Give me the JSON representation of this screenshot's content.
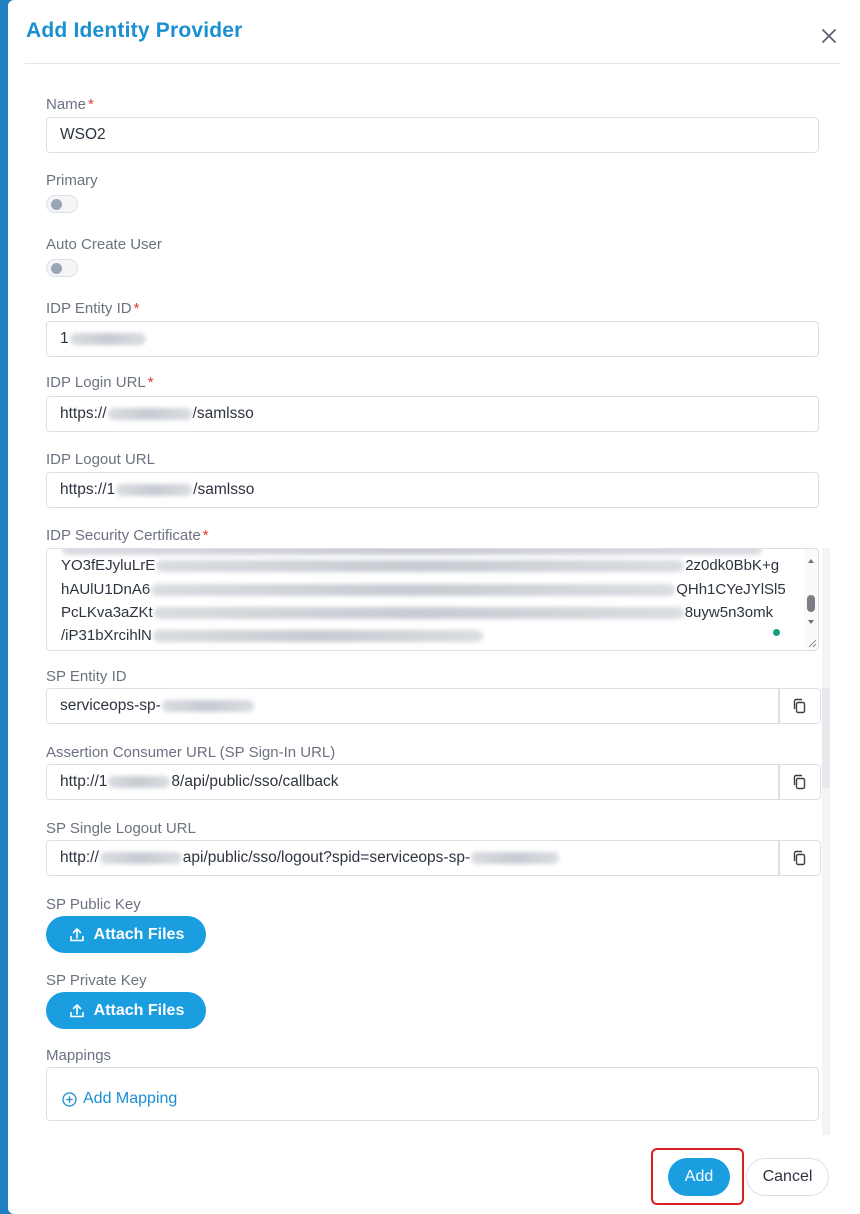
{
  "dialog": {
    "title": "Add Identity Provider"
  },
  "fields": {
    "name": {
      "label": "Name",
      "required": "*",
      "value": "WSO2"
    },
    "primary": {
      "label": "Primary",
      "enabled": false
    },
    "auto_create_user": {
      "label": "Auto Create User",
      "enabled": false
    },
    "idp_entity_id": {
      "label": "IDP Entity ID",
      "required": "*",
      "value_prefix": "1"
    },
    "idp_login_url": {
      "label": "IDP Login URL",
      "required": "*",
      "value_prefix": "https://",
      "value_suffix": "/samlsso"
    },
    "idp_logout_url": {
      "label": "IDP Logout URL",
      "value_prefix": "https://1",
      "value_suffix": "/samlsso"
    },
    "idp_security_certificate": {
      "label": "IDP Security Certificate",
      "required": "*",
      "lines": [
        {
          "left": "YO3fEJyluLrE",
          "right": "2z0dk0BbK+g"
        },
        {
          "left": "hAUlU1DnA6",
          "right": "QHh1CYeJYlSl5"
        },
        {
          "left": "PcLKva3aZKt",
          "right": "8uyw5n3omk"
        },
        {
          "left": "/iP31bXrcihlN",
          "right": ""
        }
      ]
    },
    "sp_entity_id": {
      "label": "SP Entity ID",
      "value_prefix": "serviceops-sp-"
    },
    "assertion_consumer_url": {
      "label": "Assertion Consumer URL (SP Sign-In URL)",
      "value_prefix": "http://1",
      "value_suffix": "8/api/public/sso/callback"
    },
    "sp_single_logout_url": {
      "label": "SP Single Logout URL",
      "value_prefix": "http://",
      "value_suffix": "api/public/sso/logout?spid=serviceops-sp-"
    },
    "sp_public_key": {
      "label": "SP Public Key",
      "button": "Attach Files"
    },
    "sp_private_key": {
      "label": "SP Private Key",
      "button": "Attach Files"
    },
    "mappings": {
      "label": "Mappings",
      "add_label": "Add Mapping"
    }
  },
  "footer": {
    "add_label": "Add",
    "cancel_label": "Cancel"
  },
  "colors": {
    "accent": "#1a9ee0",
    "title": "#1a8fd1",
    "required": "#d83a3a",
    "highlight": "#d81f1f"
  }
}
